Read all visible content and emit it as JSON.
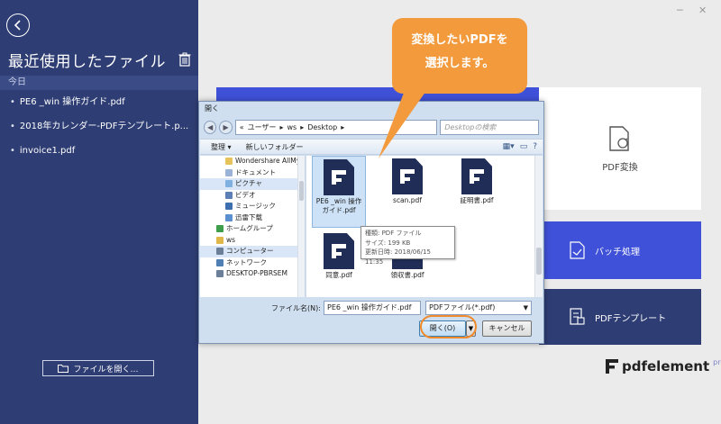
{
  "sidebar": {
    "title": "最近使用したファイル",
    "section_label": "今日",
    "files": [
      "PE6 _win 操作ガイド.pdf",
      "2018年カレンダー-PDFテンプレート.p...",
      "invoice1.pdf"
    ],
    "open_button": "ファイルを開く…",
    "bg_color": "#2e3d73"
  },
  "cards": {
    "convert": "PDF変換",
    "batch": "バッチ処理",
    "template": "PDFテンプレート"
  },
  "logo": {
    "text": "pdfelement",
    "badge": "pro"
  },
  "callout": {
    "line1": "変換したいPDFを",
    "line2": "選択します。",
    "color": "#f29a3c"
  },
  "dialog": {
    "title": "開く",
    "path": [
      "«",
      "ユーザー",
      "▸",
      "ws",
      "▸",
      "Desktop",
      "▸"
    ],
    "search_placeholder": "Desktopの検索",
    "toolbar": {
      "organize": "整理 ▾",
      "new_folder": "新しいフォルダー"
    },
    "nav_items": [
      {
        "label": "Wondershare AllMy",
        "icon": "folder",
        "sel": false
      },
      {
        "label": "ドキュメント",
        "icon": "doc",
        "sel": false
      },
      {
        "label": "ピクチャ",
        "icon": "pic",
        "sel": true
      },
      {
        "label": "ビデオ",
        "icon": "video",
        "sel": false
      },
      {
        "label": "ミュージック",
        "icon": "music",
        "sel": false
      },
      {
        "label": "迅雷下载",
        "icon": "dl",
        "sel": false
      },
      {
        "label": "ホームグループ",
        "icon": "home",
        "sel": false
      },
      {
        "label": "ws",
        "icon": "user",
        "sel": false
      },
      {
        "label": "コンピューター",
        "icon": "pc",
        "sel": true
      },
      {
        "label": "ネットワーク",
        "icon": "net",
        "sel": false
      },
      {
        "label": "DESKTOP-PBRSEM",
        "icon": "pc",
        "sel": false
      }
    ],
    "files": [
      {
        "name": "PE6 _win 操作ガイド.pdf",
        "sel": true
      },
      {
        "name": "scan.pdf",
        "sel": false
      },
      {
        "name": "証明書.pdf",
        "sel": false
      },
      {
        "name": "同意.pdf",
        "sel": false
      },
      {
        "name": "領収書.pdf",
        "sel": false
      }
    ],
    "tooltip": {
      "type": "種類: PDF ファイル",
      "size": "サイズ: 199 KB",
      "date": "更新日時: 2018/06/15 11:35"
    },
    "filename_label": "ファイル名(N):",
    "filename_value": "PE6 _win 操作ガイド.pdf",
    "filetype_value": "PDFファイル(*.pdf)",
    "open_label": "開く(O)",
    "cancel_label": "キャンセル"
  }
}
